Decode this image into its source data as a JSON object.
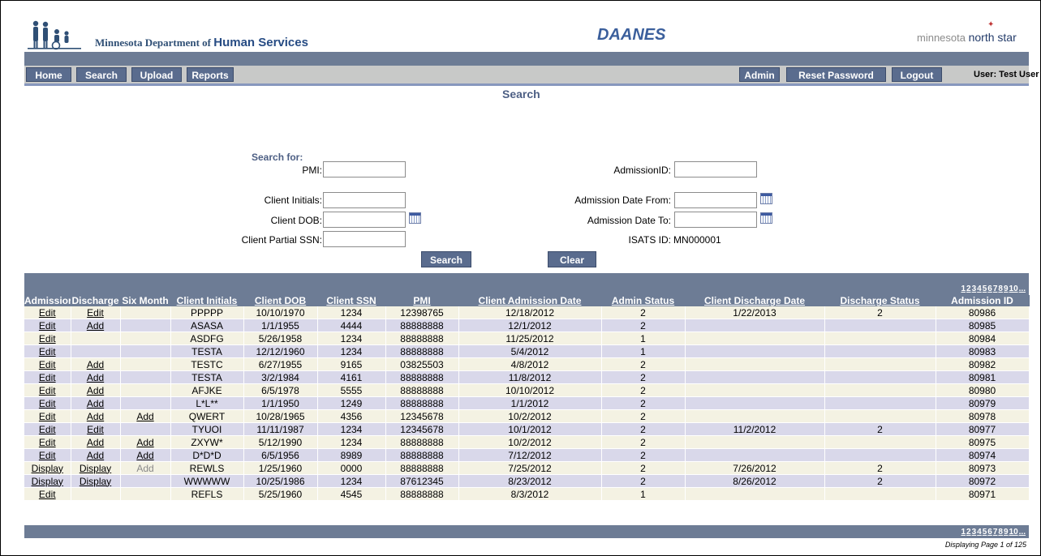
{
  "header": {
    "dept_prefix": "Minnesota Department of ",
    "dept_bold": "Human Services",
    "app_title": "DAANES",
    "northstar_prefix": "minnesota ",
    "northstar_bold": "north star"
  },
  "nav": {
    "home": "Home",
    "search": "Search",
    "upload": "Upload",
    "reports": "Reports",
    "admin": "Admin",
    "reset_password": "Reset Password",
    "logout": "Logout",
    "user": "User: Test User"
  },
  "search": {
    "title": "Search",
    "search_for": "Search for:",
    "pmi_label": "PMI:",
    "pmi_value": "",
    "client_initials_label": "Client Initials:",
    "client_initials_value": "",
    "client_dob_label": "Client DOB:",
    "client_dob_value": "",
    "client_ssn_label": "Client Partial SSN:",
    "client_ssn_value": "",
    "admission_id_label": "AdmissionID:",
    "admission_id_value": "",
    "admission_from_label": "Admission Date From:",
    "admission_from_value": "",
    "admission_to_label": "Admission Date To:",
    "admission_to_value": "",
    "isats_label": "ISATS ID:",
    "isats_value": "MN000001",
    "search_button": "Search",
    "clear_button": "Clear"
  },
  "grid": {
    "pager": [
      "1",
      "2",
      "3",
      "4",
      "5",
      "6",
      "7",
      "8",
      "9",
      "10",
      "..."
    ],
    "headers": [
      "Admission",
      "Discharge",
      "Six Month",
      "Client Initials",
      "Client DOB",
      "Client SSN",
      "PMI",
      "Client Admission Date",
      "Admin Status",
      "Client Discharge Date",
      "Discharge Status",
      "Admission ID"
    ],
    "rows": [
      [
        "Edit",
        "Edit",
        "",
        "PPPPP",
        "10/10/1970",
        "1234",
        "12398765",
        "12/18/2012",
        "2",
        "1/22/2013",
        "2",
        "80986"
      ],
      [
        "Edit",
        "Add",
        "",
        "ASASA",
        "1/1/1955",
        "4444",
        "88888888",
        "12/1/2012",
        "2",
        "",
        "",
        "80985"
      ],
      [
        "Edit",
        "",
        "",
        "ASDFG",
        "5/26/1958",
        "1234",
        "88888888",
        "11/25/2012",
        "1",
        "",
        "",
        "80984"
      ],
      [
        "Edit",
        "",
        "",
        "TESTA",
        "12/12/1960",
        "1234",
        "88888888",
        "5/4/2012",
        "1",
        "",
        "",
        "80983"
      ],
      [
        "Edit",
        "Add",
        "",
        "TESTC",
        "6/27/1955",
        "9165",
        "03825503",
        "4/8/2012",
        "2",
        "",
        "",
        "80982"
      ],
      [
        "Edit",
        "Add",
        "",
        "TESTA",
        "3/2/1984",
        "4161",
        "88888888",
        "11/8/2012",
        "2",
        "",
        "",
        "80981"
      ],
      [
        "Edit",
        "Add",
        "",
        "AFJKE",
        "6/5/1978",
        "5555",
        "88888888",
        "10/10/2012",
        "2",
        "",
        "",
        "80980"
      ],
      [
        "Edit",
        "Add",
        "",
        "L*L**",
        "1/1/1950",
        "1249",
        "88888888",
        "1/1/2012",
        "2",
        "",
        "",
        "80979"
      ],
      [
        "Edit",
        "Add",
        "Add",
        "QWERT",
        "10/28/1965",
        "4356",
        "12345678",
        "10/2/2012",
        "2",
        "",
        "",
        "80978"
      ],
      [
        "Edit",
        "Edit",
        "",
        "TYUOI",
        "11/11/1987",
        "1234",
        "12345678",
        "10/1/2012",
        "2",
        "11/2/2012",
        "2",
        "80977"
      ],
      [
        "Edit",
        "Add",
        "Add",
        "ZXYW*",
        "5/12/1990",
        "1234",
        "88888888",
        "10/2/2012",
        "2",
        "",
        "",
        "80975"
      ],
      [
        "Edit",
        "Add",
        "Add",
        "D*D*D",
        "6/5/1956",
        "8989",
        "88888888",
        "7/12/2012",
        "2",
        "",
        "",
        "80974"
      ],
      [
        "Display",
        "Display",
        "Add",
        "REWLS",
        "1/25/1960",
        "0000",
        "88888888",
        "7/25/2012",
        "2",
        "7/26/2012",
        "2",
        "80973"
      ],
      [
        "Display",
        "Display",
        "",
        "WWWWW",
        "10/25/1986",
        "1234",
        "87612345",
        "8/23/2012",
        "2",
        "8/26/2012",
        "2",
        "80972"
      ],
      [
        "Edit",
        "",
        "",
        "REFLS",
        "5/25/1960",
        "4545",
        "88888888",
        "8/3/2012",
        "1",
        "",
        "",
        "80971"
      ]
    ],
    "displaying": "Displaying Page 1 of 125"
  },
  "colors": {
    "nav_dark": "#6d7c95",
    "button": "#5a6c8e",
    "row_odd": "#f4f2e3",
    "row_even": "#d9d8ea"
  }
}
